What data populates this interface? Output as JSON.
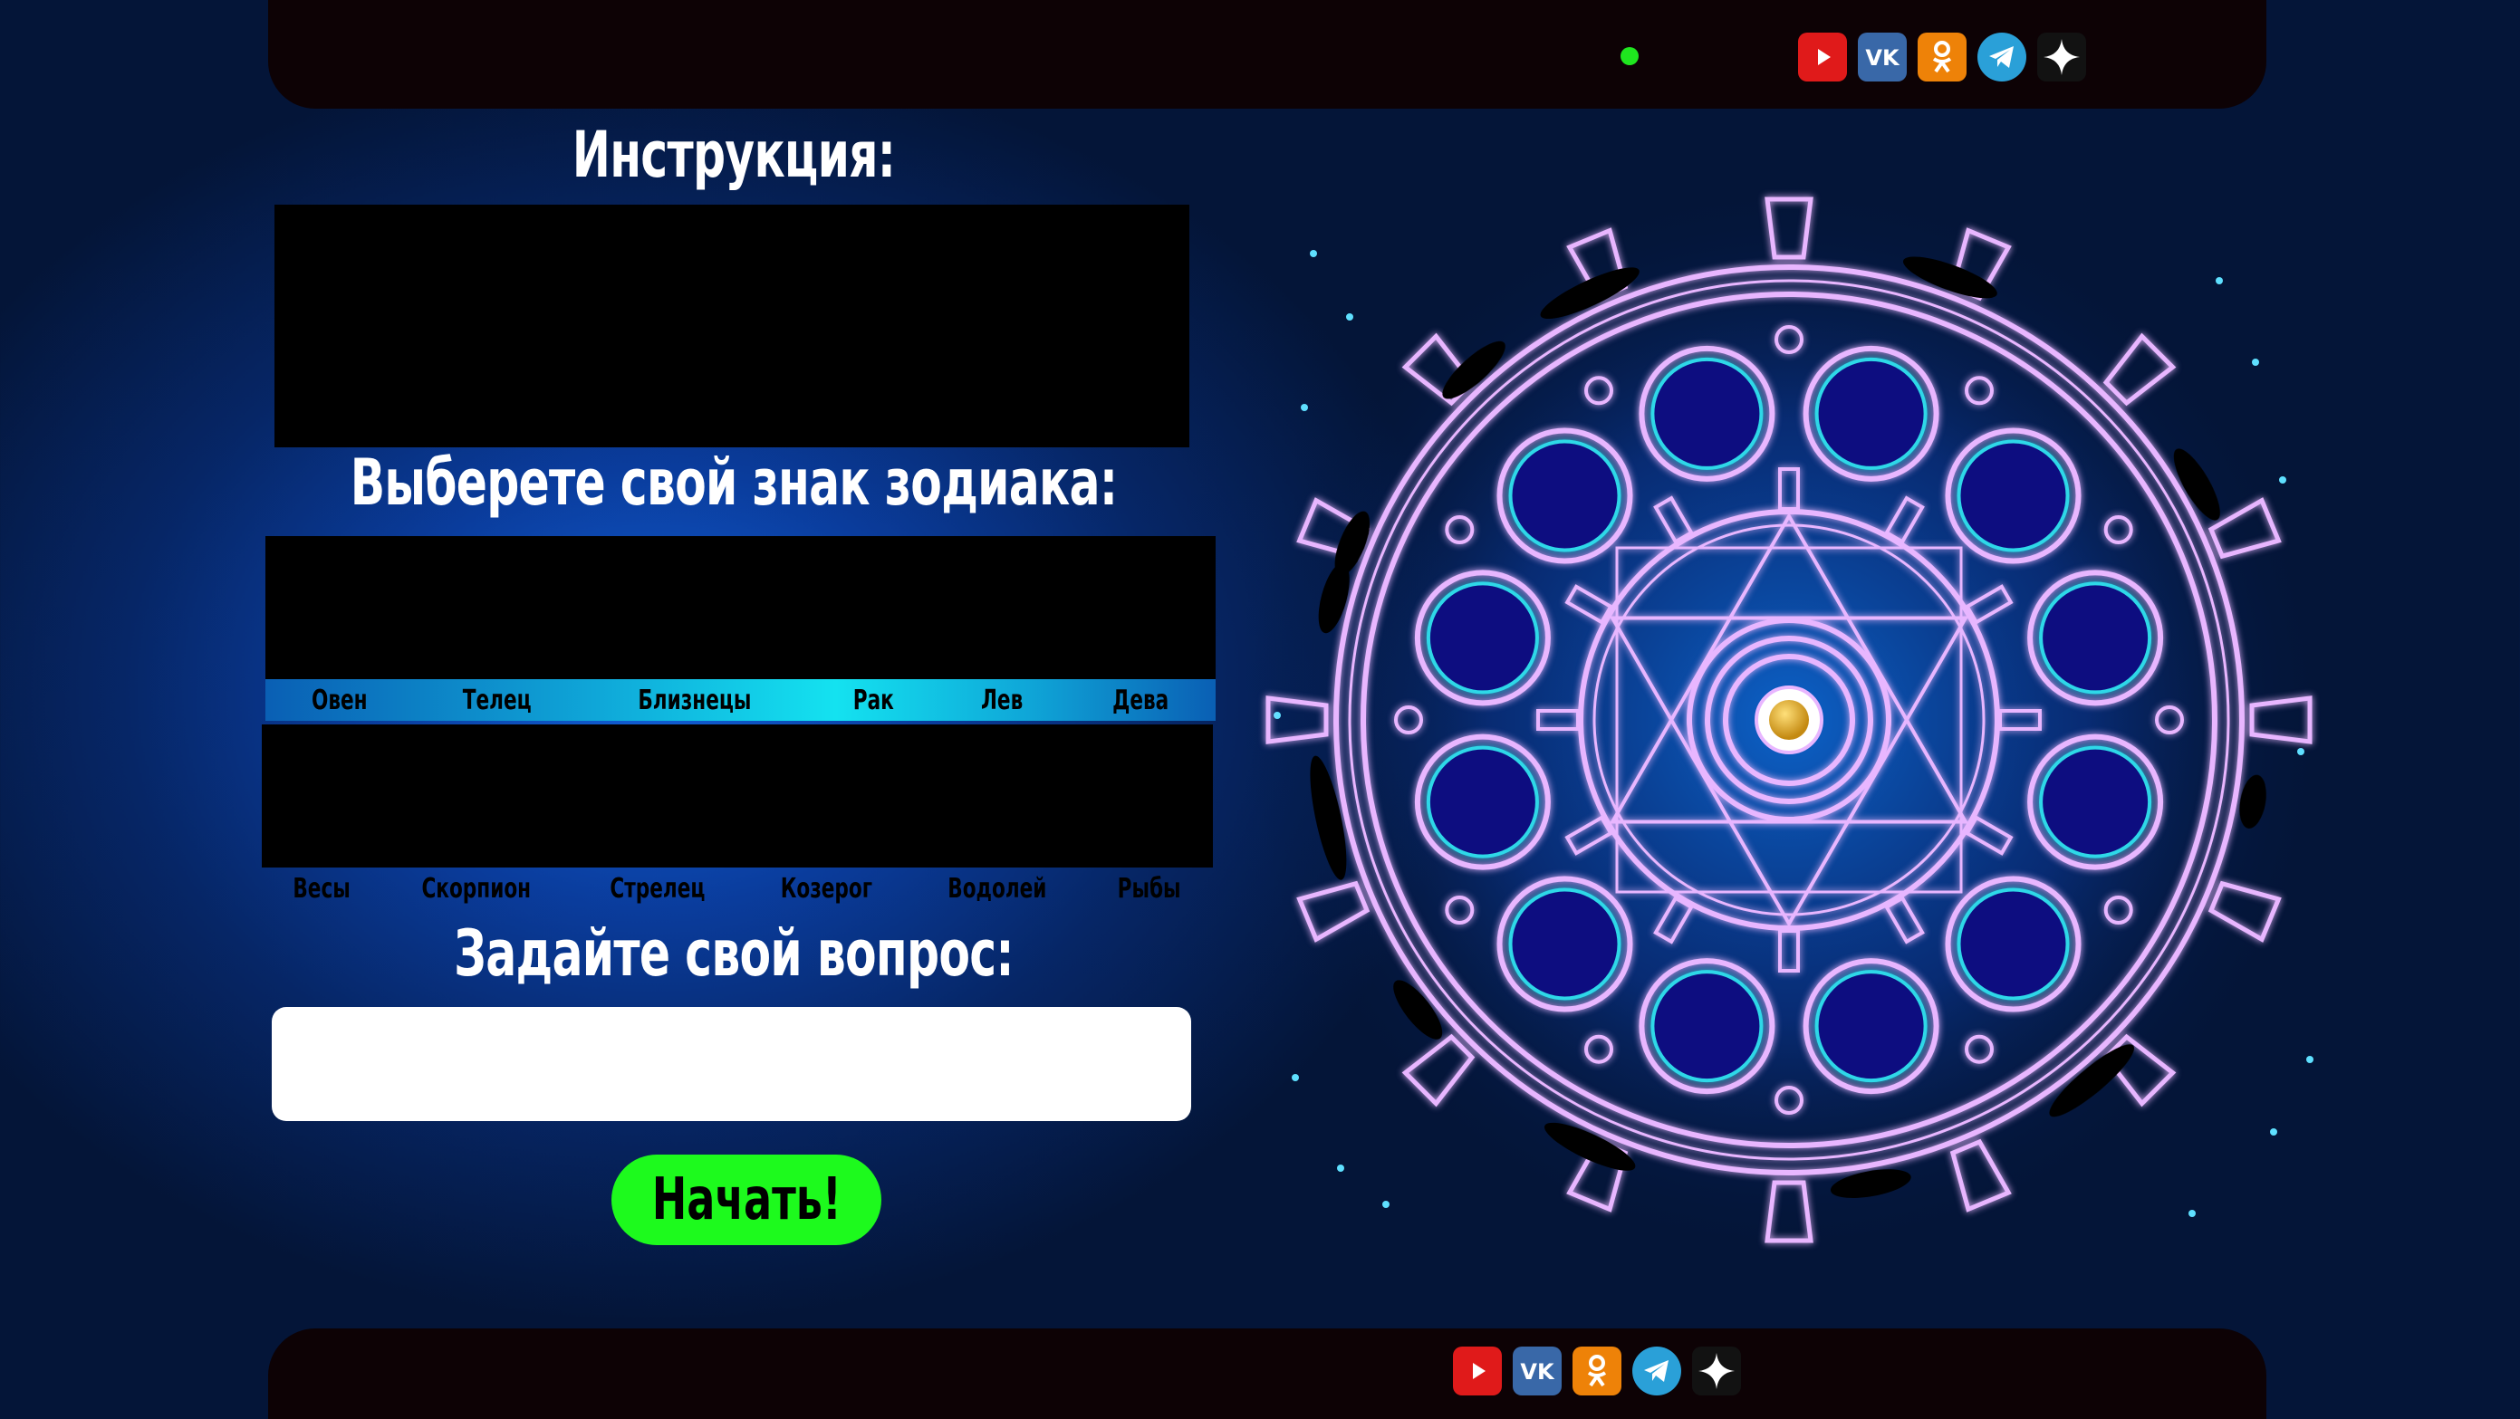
{
  "header": {
    "social_icons": [
      "youtube-icon",
      "vk-icon",
      "odnoklassniki-icon",
      "telegram-icon",
      "star-icon"
    ]
  },
  "instruction": {
    "title": "Инструкция:"
  },
  "zodiac": {
    "title": "Выберете свой знак зодиака:",
    "row1": [
      "Овен",
      "Телец",
      "Близнецы",
      "Рак",
      "Лев",
      "Дева"
    ],
    "row2": [
      "Весы",
      "Скорпион",
      "Стрелец",
      "Козерог",
      "Водолей",
      "Рыбы"
    ]
  },
  "question": {
    "title": "Задайте свой вопрос:",
    "value": "",
    "placeholder": ""
  },
  "start_button": {
    "label": "Начать!"
  },
  "footer": {
    "social_icons": [
      "youtube-icon",
      "vk-icon",
      "odnoklassniki-icon",
      "telegram-icon",
      "star-icon"
    ]
  },
  "colors": {
    "accent_green": "#1dfa1d",
    "wheel_glow": "#e3a6ff",
    "wheel_circle": "#0c0c80"
  }
}
